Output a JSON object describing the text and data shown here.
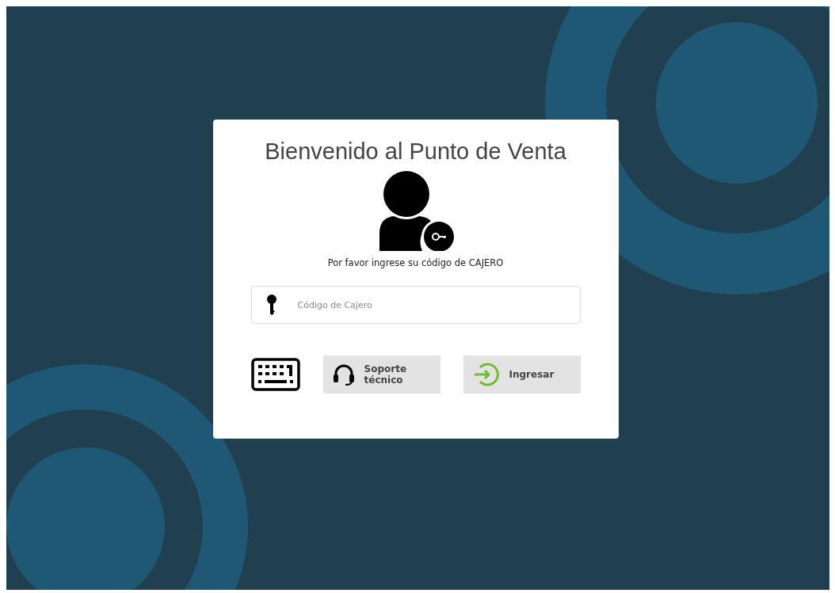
{
  "login_card": {
    "title": "Bienvenido al Punto de Venta",
    "prompt": "Por favor ingrese su código de CAJERO",
    "code_field": {
      "placeholder": "Código de Cajero"
    },
    "actions": [
      {
        "kind": "keyboard"
      },
      {
        "kind": "support",
        "label": "Soporte técnico"
      },
      {
        "kind": "login",
        "label": "Ingresar"
      }
    ]
  }
}
